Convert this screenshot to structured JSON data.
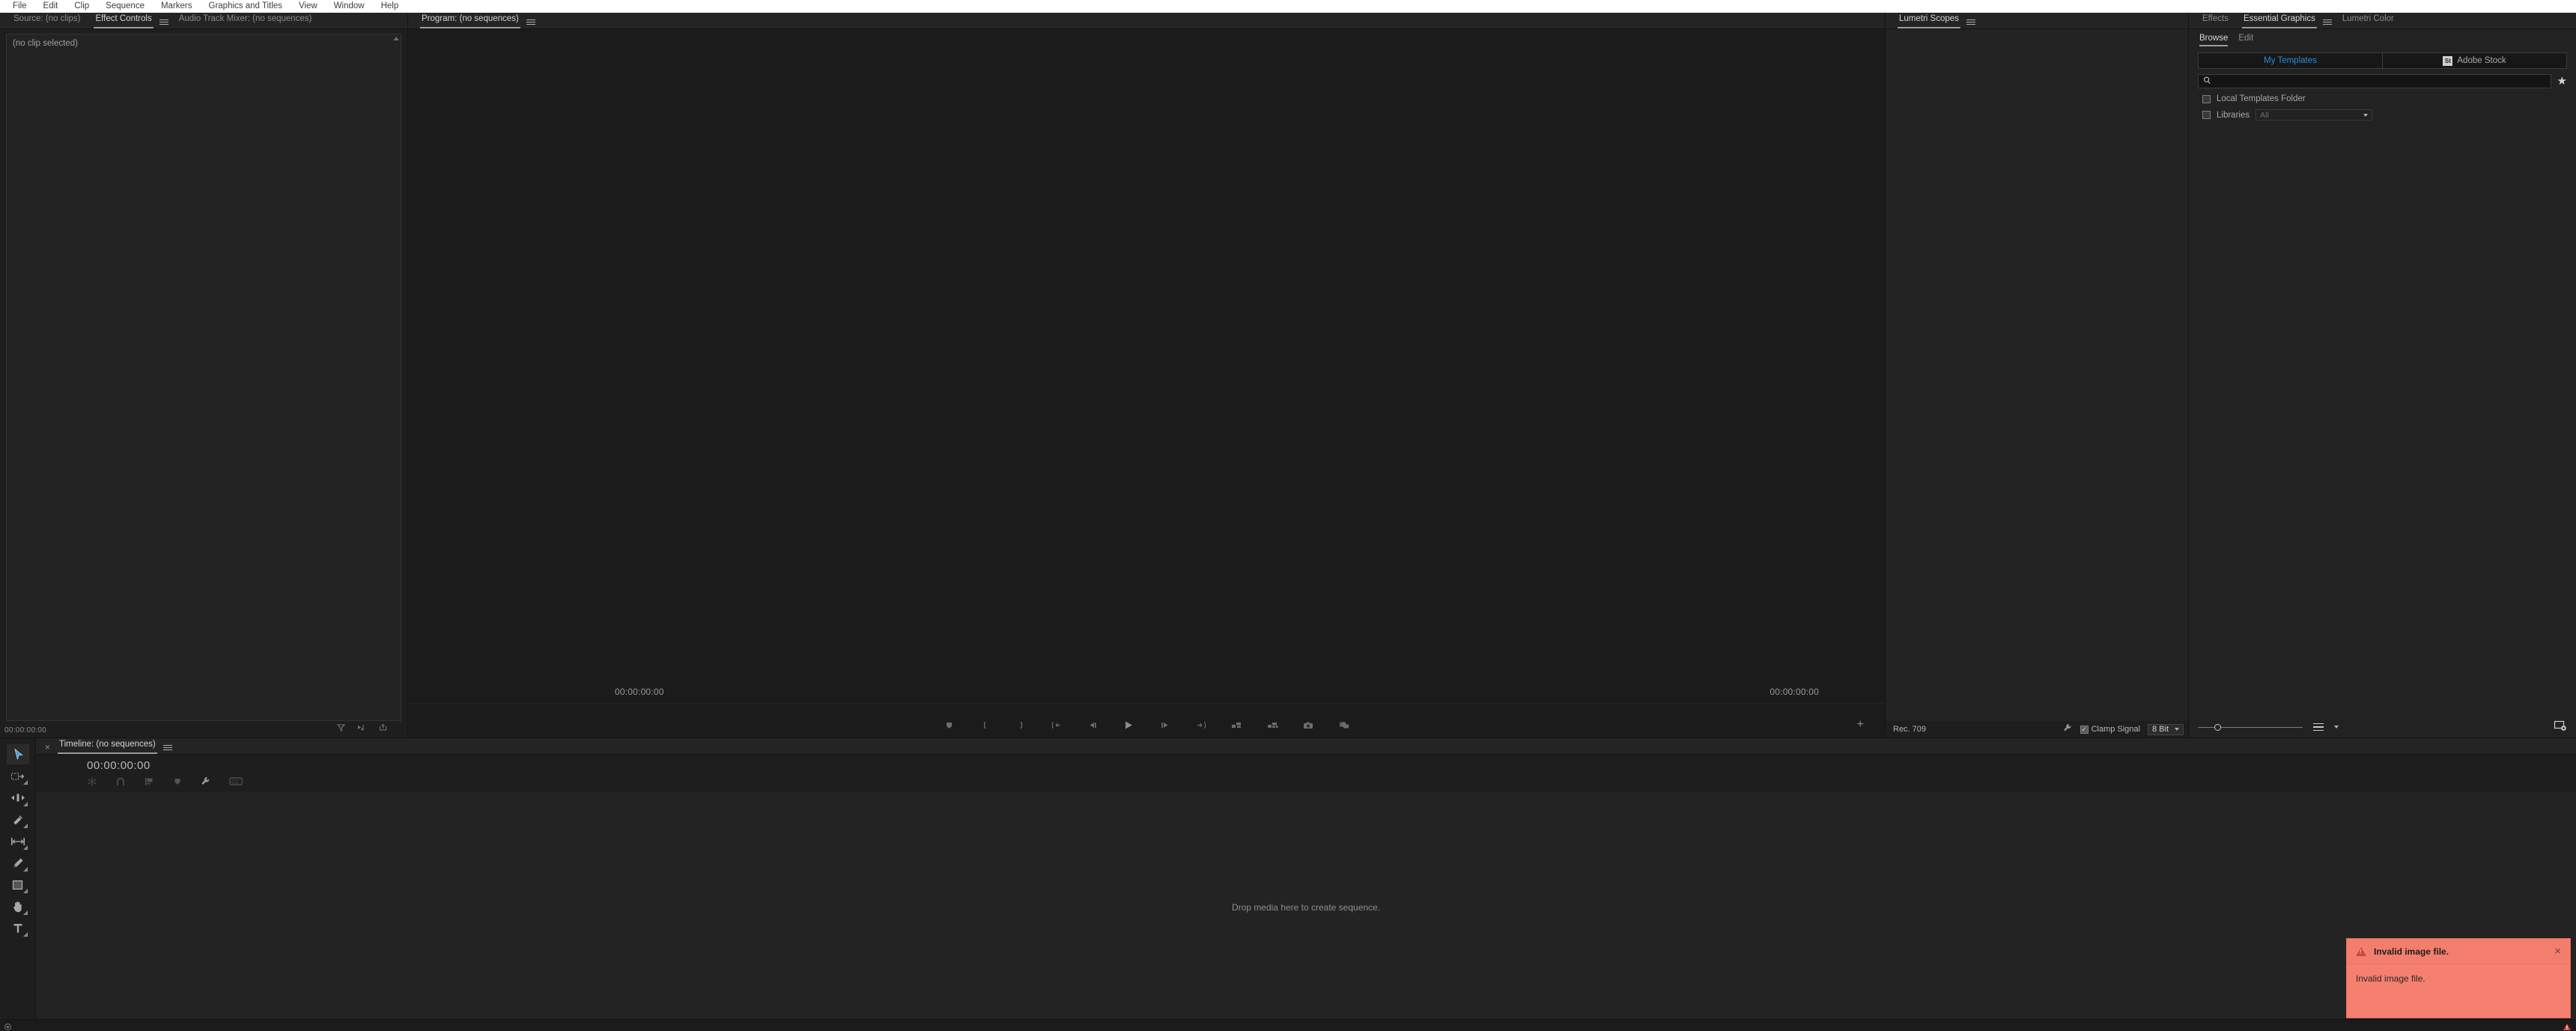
{
  "menubar": {
    "items": [
      "File",
      "Edit",
      "Clip",
      "Sequence",
      "Markers",
      "Graphics and Titles",
      "View",
      "Window",
      "Help"
    ]
  },
  "effect_controls": {
    "tabs": [
      {
        "label": "Source: (no clips)",
        "active": false
      },
      {
        "label": "Effect Controls",
        "active": true
      },
      {
        "label": "Audio Track Mixer: (no sequences)",
        "active": false
      }
    ],
    "empty_text": "(no clip selected)",
    "timecode": "00:00:00:00",
    "footer_icons": [
      "filter-icon",
      "play-audio-icon",
      "export-icon"
    ]
  },
  "program_monitor": {
    "tab_label": "Program: (no sequences)",
    "timecode_left": "00:00:00:00",
    "timecode_right": "00:00:00:00",
    "transport_icons": [
      "add-marker-icon",
      "mark-in-icon",
      "mark-out-icon",
      "go-to-in-icon",
      "step-back-icon",
      "play-stop-icon",
      "step-forward-icon",
      "go-to-out-icon",
      "lift-icon",
      "extract-icon",
      "export-frame-icon",
      "comparison-view-icon"
    ],
    "button_editor_label": "+"
  },
  "lumetri_scopes": {
    "tab_label": "Lumetri Scopes",
    "color_space": "Rec. 709",
    "settings_icon": "wrench-icon",
    "clamp_signal_label": "Clamp Signal",
    "clamp_signal_checked": true,
    "bit_depth": "8 Bit"
  },
  "essential_graphics": {
    "tabs": [
      {
        "label": "Effects",
        "active": false
      },
      {
        "label": "Essential Graphics",
        "active": true
      },
      {
        "label": "Lumetri Color",
        "active": false
      }
    ],
    "subtabs": [
      {
        "label": "Browse",
        "active": true
      },
      {
        "label": "Edit",
        "active": false
      }
    ],
    "segments": [
      {
        "label": "My Templates",
        "active": true,
        "badge": ""
      },
      {
        "label": "Adobe Stock",
        "active": false,
        "badge": "St"
      }
    ],
    "search_placeholder": "",
    "search_value": "",
    "favorite_icon": "star-icon",
    "filters": [
      {
        "label": "Local Templates Folder",
        "checked": false,
        "has_select": false,
        "select_value": ""
      },
      {
        "label": "Libraries",
        "checked": false,
        "has_select": true,
        "select_value": "All"
      }
    ],
    "footer": {
      "zoom_slider_value": 15,
      "sort_icon": "list-sort-icon",
      "new_layer_icon": "new-layer-icon"
    }
  },
  "timeline": {
    "tab_label": "Timeline: (no sequences)",
    "timecode": "00:00:00:00",
    "tool_icons": [
      "snap-icon",
      "linked-selection-icon",
      "marker-overlay-icon",
      "add-marker-icon",
      "timeline-settings-icon",
      "captions-icon"
    ],
    "drop_hint": "Drop media here to create sequence."
  },
  "toolbar": {
    "tools": [
      {
        "name": "selection-tool",
        "glyph": "arrow",
        "active": true,
        "has_flyout": false
      },
      {
        "name": "track-select-forward-tool",
        "glyph": "track-select",
        "active": false,
        "has_flyout": true
      },
      {
        "name": "ripple-edit-tool",
        "glyph": "ripple",
        "active": false,
        "has_flyout": true
      },
      {
        "name": "razor-tool",
        "glyph": "razor",
        "active": false,
        "has_flyout": true
      },
      {
        "name": "slip-tool",
        "glyph": "slip",
        "active": false,
        "has_flyout": true
      },
      {
        "name": "pen-tool",
        "glyph": "pen",
        "active": false,
        "has_flyout": true
      },
      {
        "name": "rectangle-tool",
        "glyph": "rect",
        "active": false,
        "has_flyout": true
      },
      {
        "name": "hand-tool",
        "glyph": "hand",
        "active": false,
        "has_flyout": true
      },
      {
        "name": "type-tool",
        "glyph": "type",
        "active": false,
        "has_flyout": true
      }
    ]
  },
  "toast": {
    "title": "Invalid image file.",
    "body": "Invalid image file.",
    "close_label": "×",
    "icon": "warning-icon",
    "background_color": "#f58070"
  },
  "statusbar": {
    "left_icon": "record-icon",
    "right_icon": "warning-indicator-icon"
  },
  "colors": {
    "panel_bg": "#1e1e1e",
    "tab_bg": "#242424",
    "accent_blue": "#2a8cd8",
    "text": "#c8c8c8",
    "menubar_bg": "#ffffff"
  }
}
